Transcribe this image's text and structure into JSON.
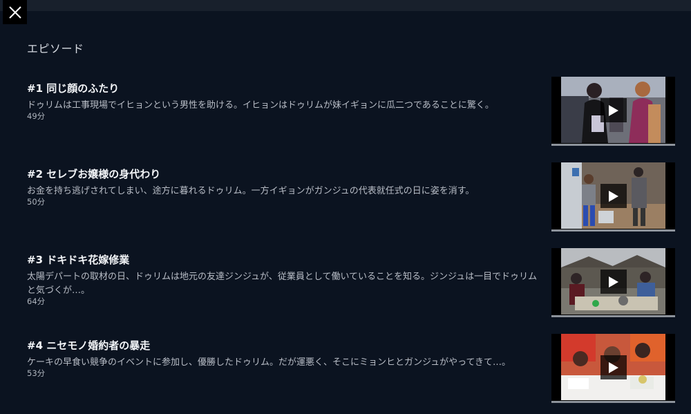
{
  "section": {
    "title": "エピソード"
  },
  "episodes": [
    {
      "title": "#1 同じ顔のふたり",
      "description": "ドゥリムは工事現場でイヒョンという男性を助ける。イヒョンはドゥリムが妹イギョンに瓜二つであることに驚く。",
      "duration": "49分"
    },
    {
      "title": "#2 セレブお嬢様の身代わり",
      "description": "お金を持ち逃げされてしまい、途方に暮れるドゥリム。一方イギョンがガンジュの代表就任式の日に姿を消す。",
      "duration": "50分"
    },
    {
      "title": "#3 ドキドキ花嫁修業",
      "description": "太陽デパートの取材の日、ドゥリムは地元の友達ジンジュが、従業員として働いていることを知る。ジンジュは一目でドゥリムと気づくが…。",
      "duration": "64分"
    },
    {
      "title": "#4 ニセモノ婚約者の暴走",
      "description": "ケーキの早食い競争のイベントに参加し、優勝したドゥリム。だが運悪く、そこにミョンヒとガンジュがやってきて…。",
      "duration": "53分"
    }
  ],
  "icons": {
    "close": "close-icon",
    "play": "play-icon"
  },
  "colors": {
    "background": "#0b1320",
    "topbar": "#18202c",
    "text_primary": "#f2f4f7",
    "text_secondary": "#b8bdc6"
  }
}
